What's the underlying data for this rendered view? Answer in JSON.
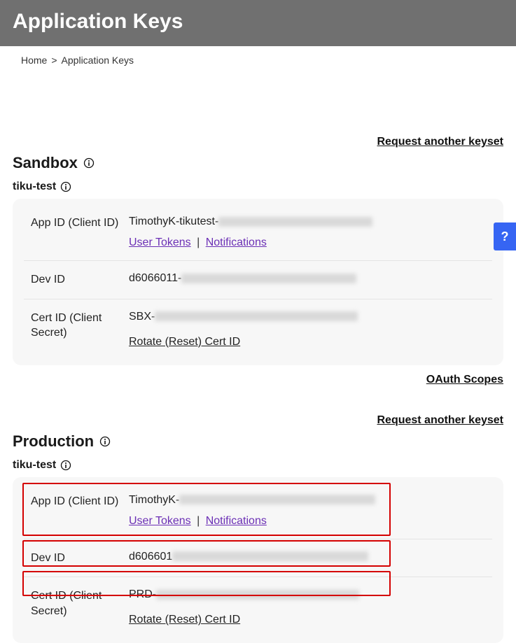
{
  "header": {
    "title": "Application Keys"
  },
  "breadcrumb": {
    "home": "Home",
    "current": "Application Keys"
  },
  "actions": {
    "request_keyset": "Request another keyset",
    "oauth_scopes": "OAuth Scopes"
  },
  "labels": {
    "app_id": "App ID (Client ID)",
    "dev_id": "Dev ID",
    "cert_id": "Cert ID (Client Secret)"
  },
  "links": {
    "user_tokens": "User Tokens",
    "notifications": "Notifications",
    "rotate": "Rotate (Reset) Cert ID"
  },
  "sandbox": {
    "title": "Sandbox",
    "app_name": "tiku-test",
    "app_id_prefix": "TimothyK-tikutest-",
    "dev_id_prefix": "d6066011-",
    "cert_id_prefix": "SBX-"
  },
  "production": {
    "title": "Production",
    "app_name": "tiku-test",
    "app_id_prefix": "TimothyK-",
    "dev_id_prefix": "d606601",
    "cert_id_prefix": "PRD-"
  },
  "help": {
    "label": "?"
  }
}
